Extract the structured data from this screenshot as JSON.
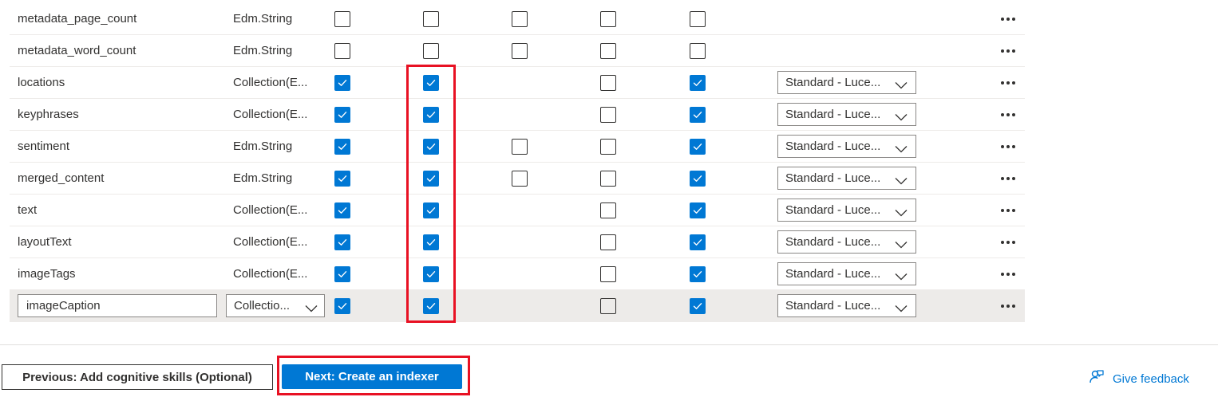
{
  "fields": [
    {
      "name": "metadata_page_count",
      "type": "Edm.String",
      "cb": [
        false,
        false,
        false,
        false,
        false
      ],
      "analyzer": null
    },
    {
      "name": "metadata_word_count",
      "type": "Edm.String",
      "cb": [
        false,
        false,
        false,
        false,
        false
      ],
      "analyzer": null
    },
    {
      "name": "locations",
      "type": "Collection(E...",
      "cb": [
        true,
        true,
        null,
        false,
        true
      ],
      "analyzer": "Standard - Luce..."
    },
    {
      "name": "keyphrases",
      "type": "Collection(E...",
      "cb": [
        true,
        true,
        null,
        false,
        true
      ],
      "analyzer": "Standard - Luce..."
    },
    {
      "name": "sentiment",
      "type": "Edm.String",
      "cb": [
        true,
        true,
        false,
        false,
        true
      ],
      "analyzer": "Standard - Luce..."
    },
    {
      "name": "merged_content",
      "type": "Edm.String",
      "cb": [
        true,
        true,
        false,
        false,
        true
      ],
      "analyzer": "Standard - Luce..."
    },
    {
      "name": "text",
      "type": "Collection(E...",
      "cb": [
        true,
        true,
        null,
        false,
        true
      ],
      "analyzer": "Standard - Luce..."
    },
    {
      "name": "layoutText",
      "type": "Collection(E...",
      "cb": [
        true,
        true,
        null,
        false,
        true
      ],
      "analyzer": "Standard - Luce..."
    },
    {
      "name": "imageTags",
      "type": "Collection(E...",
      "cb": [
        true,
        true,
        null,
        false,
        true
      ],
      "analyzer": "Standard - Luce..."
    },
    {
      "name": "imageCaption",
      "type": "Collectio...",
      "cb": [
        true,
        true,
        null,
        false,
        true
      ],
      "analyzer": "Standard - Luce...",
      "editing": true
    }
  ],
  "footer": {
    "prev_label": "Previous: Add cognitive skills (Optional)",
    "next_label": "Next: Create an indexer",
    "feedback_label": "Give feedback"
  },
  "colors": {
    "accent": "#0078d4",
    "highlight": "#e81123"
  },
  "icons": {
    "more": "more-horizontal-icon",
    "chevron": "chevron-down-icon",
    "check": "checkmark-icon",
    "feedback": "feedback-icon"
  }
}
